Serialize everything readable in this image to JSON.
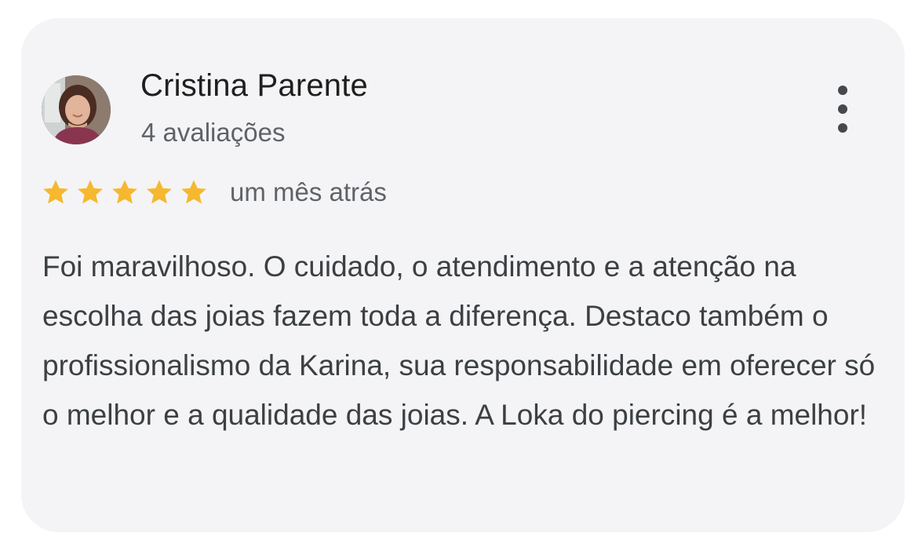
{
  "review": {
    "author": {
      "name": "Cristina Parente",
      "reviews_count": "4 avaliações",
      "avatar_icon": "user-photo"
    },
    "rating": 5,
    "rating_max": 5,
    "date": "um mês atrás",
    "text": "Foi maravilhoso. O cuidado, o atendimento e a atenção na escolha das joias fazem toda a diferença. Destaco também o profissionalismo da Karina, sua responsabilidade em oferecer só o melhor e a qualidade das joias. A Loka do piercing é a melhor!"
  },
  "menu": {
    "icon": "more-vert-icon"
  },
  "colors": {
    "card_background": "#f4f4f6",
    "star": "#f5b82e",
    "name_text": "#1f1f1f",
    "secondary_text": "#5f6368",
    "body_text": "#3c4043"
  }
}
